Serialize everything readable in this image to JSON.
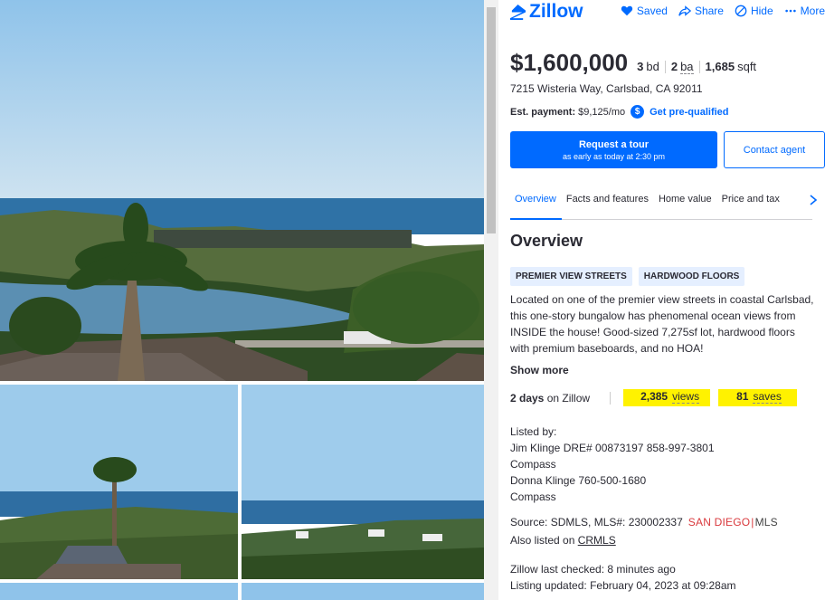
{
  "header": {
    "logo_text": "Zillow",
    "actions": [
      {
        "label": "Saved",
        "icon": "heart-icon"
      },
      {
        "label": "Share",
        "icon": "share-icon"
      },
      {
        "label": "Hide",
        "icon": "hide-icon"
      },
      {
        "label": "More",
        "icon": "more-icon"
      }
    ]
  },
  "listing": {
    "price": "$1,600,000",
    "beds_value": "3",
    "beds_unit": "bd",
    "baths_value": "2",
    "baths_unit": "ba",
    "sqft_value": "1,685",
    "sqft_unit": "sqft",
    "address": "7215 Wisteria Way, Carlsbad, CA 92011",
    "payment_label": "Est. payment:",
    "payment_value": "$9,125/mo",
    "payment_icon_symbol": "$",
    "prequal_link": "Get pre-qualified"
  },
  "buttons": {
    "tour_line1": "Request a tour",
    "tour_line2": "as early as today at 2:30 pm",
    "contact": "Contact agent"
  },
  "tabs": [
    "Overview",
    "Facts and features",
    "Home value",
    "Price and tax"
  ],
  "overview": {
    "title": "Overview",
    "chips": [
      "PREMIER VIEW STREETS",
      "HARDWOOD FLOORS"
    ],
    "description": "Located on one of the premier view streets in coastal Carlsbad, this one-story bungalow has phenomenal ocean views from INSIDE the house! Good-sized 7,275sf lot, hardwood floors with premium baseboards, and no HOA!",
    "show_more": "Show more",
    "days_value": "2 days",
    "days_suffix": "on Zillow",
    "views_value": "2,385",
    "views_label": "views",
    "saves_value": "81",
    "saves_label": "saves"
  },
  "listed_by": {
    "heading": "Listed by:",
    "lines": [
      "Jim Klinge DRE# 00873197 858-997-3801",
      "Compass",
      "Donna Klinge 760-500-1680",
      "Compass"
    ]
  },
  "source": {
    "text": "Source: SDMLS,  MLS#: 230002337",
    "mls_logo_sd": "SAN DIEGO",
    "mls_logo_mls": "MLS",
    "also_prefix": "Also listed on",
    "also_link": "CRMLS"
  },
  "meta": {
    "last_checked": "Zillow last checked: 8 minutes ago",
    "listing_updated": "Listing updated: February 04, 2023 at 09:28am"
  },
  "colors": {
    "brand": "#006aff",
    "highlight": "#fff200",
    "chip_bg": "#e5efff",
    "mls_red": "#d9393d"
  }
}
